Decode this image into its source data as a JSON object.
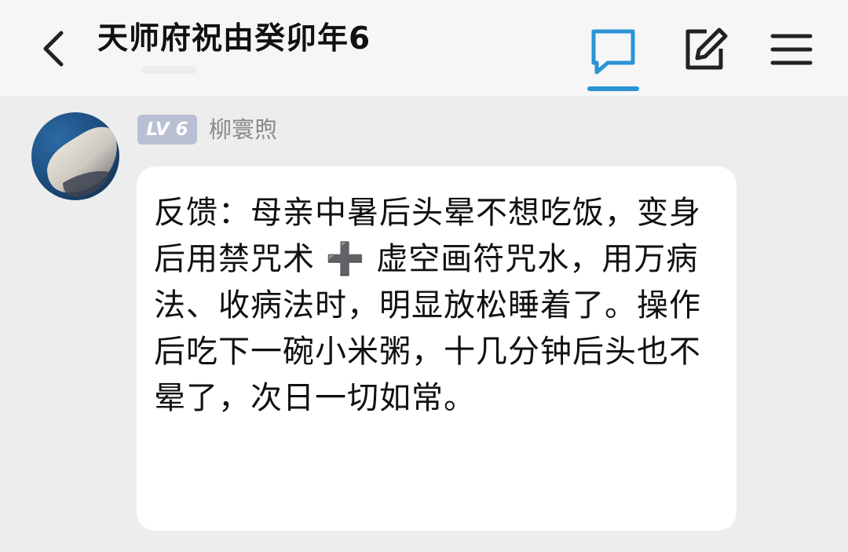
{
  "header": {
    "back_icon": "chevron-left-icon",
    "title": "天师府祝由癸卯年6",
    "actions": [
      {
        "name": "chat-icon",
        "active": true
      },
      {
        "name": "edit-icon"
      },
      {
        "name": "menu-icon"
      }
    ],
    "accent_color": "#2a93d6"
  },
  "post": {
    "level_badge": "LV 6",
    "username": "柳寰煦",
    "content": "反馈：母亲中暑后头晕不想吃饭，变身后用禁咒术 ➕ 虚空画符咒水，用万病法、收病法时，明显放松睡着了。操作后吃下一碗小米粥，十几分钟后头也不晕了，次日一切如常。"
  }
}
